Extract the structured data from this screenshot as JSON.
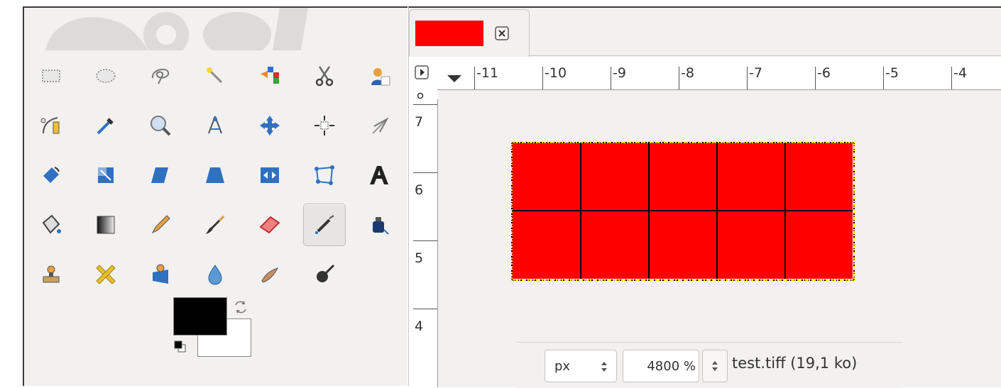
{
  "toolbox": {
    "tools": [
      {
        "name": "rect-select-icon"
      },
      {
        "name": "ellipse-select-icon"
      },
      {
        "name": "free-select-icon"
      },
      {
        "name": "fuzzy-select-icon"
      },
      {
        "name": "select-by-color-icon"
      },
      {
        "name": "scissors-select-icon"
      },
      {
        "name": "foreground-select-icon"
      },
      {
        "name": "paths-icon"
      },
      {
        "name": "color-picker-icon"
      },
      {
        "name": "zoom-icon"
      },
      {
        "name": "measure-icon"
      },
      {
        "name": "move-icon"
      },
      {
        "name": "align-icon"
      },
      {
        "name": "crop-icon"
      },
      {
        "name": "rotate-icon"
      },
      {
        "name": "scale-icon"
      },
      {
        "name": "shear-icon"
      },
      {
        "name": "perspective-icon"
      },
      {
        "name": "flip-icon"
      },
      {
        "name": "cage-transform-icon"
      },
      {
        "name": "text-icon"
      },
      {
        "name": "bucket-fill-icon"
      },
      {
        "name": "blend-icon"
      },
      {
        "name": "pencil-icon"
      },
      {
        "name": "paintbrush-icon"
      },
      {
        "name": "eraser-icon"
      },
      {
        "name": "airbrush-icon",
        "active": true
      },
      {
        "name": "ink-icon"
      },
      {
        "name": "clone-icon"
      },
      {
        "name": "heal-icon"
      },
      {
        "name": "perspective-clone-icon"
      },
      {
        "name": "blur-sharpen-icon"
      },
      {
        "name": "smudge-icon"
      },
      {
        "name": "dodge-burn-icon"
      }
    ],
    "foreground_color": "#000000",
    "background_color": "#ffffff"
  },
  "image_window": {
    "tab_thumbnail_color": "#ff0000",
    "ruler_h_labels": [
      "-11",
      "-10",
      "-9",
      "-8",
      "-7",
      "-6",
      "-5",
      "-4"
    ],
    "ruler_v_labels": [
      "7",
      "6",
      "5",
      "4"
    ],
    "image_color": "#ff0000",
    "status": {
      "unit": "px",
      "zoom": "4800 %",
      "title": "test.tiff (19,1 ko)"
    }
  }
}
